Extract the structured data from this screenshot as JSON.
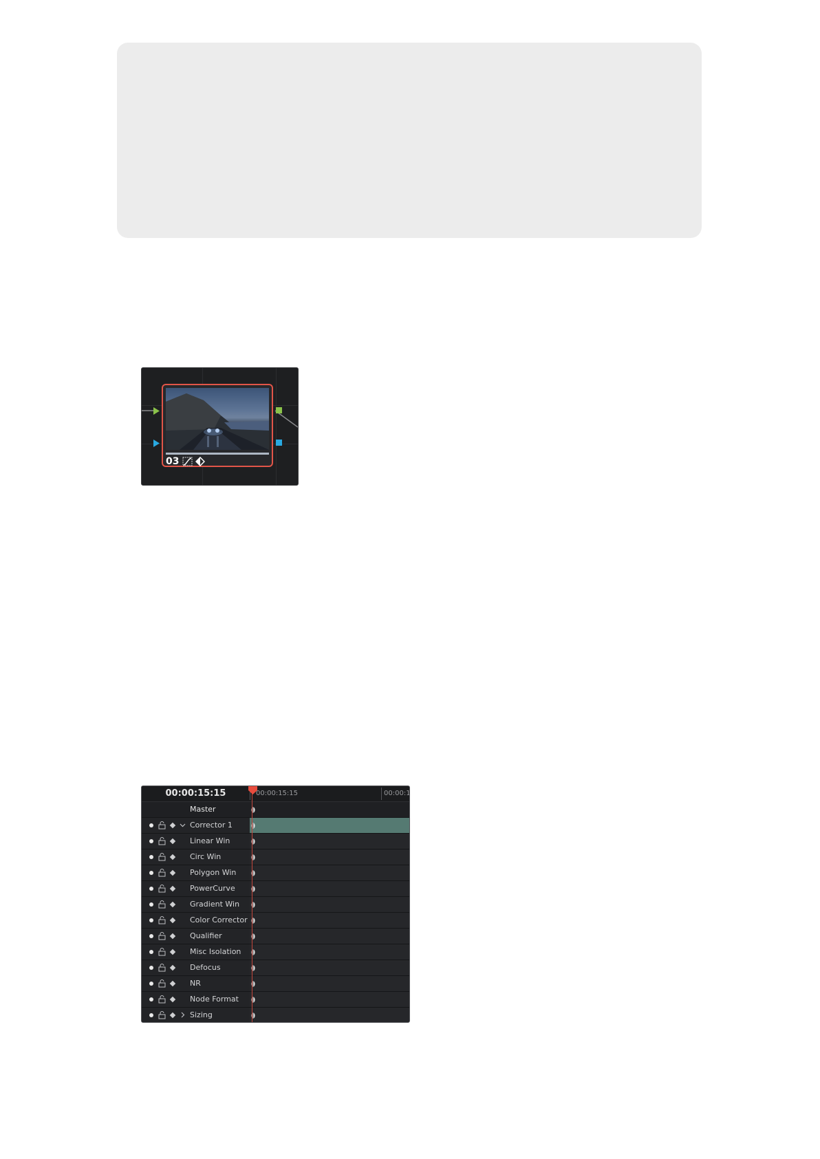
{
  "node": {
    "number": "03",
    "colors": {
      "border": "#e25548",
      "input_rgb": "#8bc34a",
      "input_key": "#29a9e1",
      "output_rgb": "#8bc34a",
      "output_key": "#29a9e1"
    },
    "icons": [
      "curve-icon",
      "keyframe-icon"
    ]
  },
  "keyframes": {
    "timecode": "00:00:15:15",
    "ruler_labels": [
      "00:00:15:15",
      "00:00:1"
    ],
    "playhead_color": "#e84c3d",
    "master_label": "Master",
    "tracks": [
      {
        "label": "Corrector 1",
        "expand": "chevron-down",
        "active": true
      },
      {
        "label": "Linear Win"
      },
      {
        "label": "Circ Win"
      },
      {
        "label": "Polygon Win"
      },
      {
        "label": "PowerCurve"
      },
      {
        "label": "Gradient Win"
      },
      {
        "label": "Color Corrector"
      },
      {
        "label": "Qualifier"
      },
      {
        "label": "Misc Isolation"
      },
      {
        "label": "Defocus"
      },
      {
        "label": "NR"
      },
      {
        "label": "Node Format"
      },
      {
        "label": "Sizing",
        "expand": "chevron-right"
      }
    ]
  }
}
